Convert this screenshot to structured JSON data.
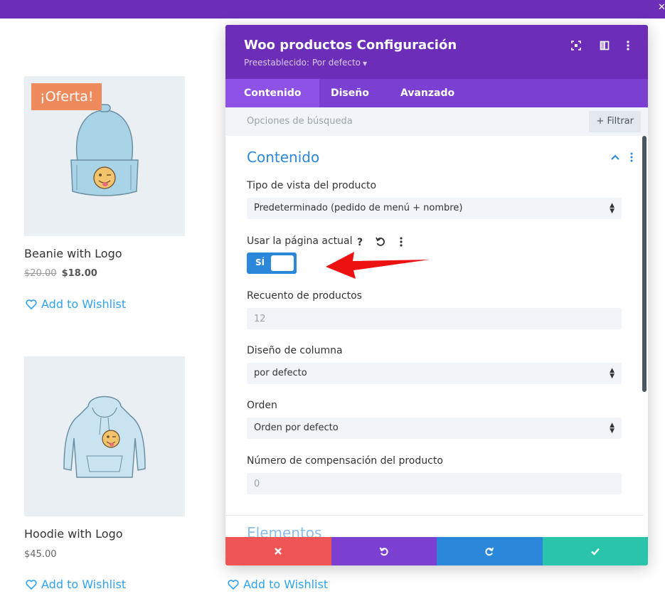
{
  "modal": {
    "title": "Woo productos Configuración",
    "preset": "Preestablecido: Por defecto",
    "tabs": [
      {
        "label": "Contenido"
      },
      {
        "label": "Diseño"
      },
      {
        "label": "Avanzado"
      }
    ],
    "search_placeholder": "Opciones de búsqueda",
    "filter_label": "+ Filtrar",
    "section_title": "Contenido",
    "next_section_title": "Elementos",
    "fields": {
      "view_type_label": "Tipo de vista del producto",
      "view_type_value": "Predeterminado (pedido de menú + nombre)",
      "use_current_label": "Usar la página actual",
      "toggle_label": "SÍ",
      "product_count_label": "Recuento de productos",
      "product_count_value": "12",
      "column_layout_label": "Diseño de columna",
      "column_layout_value": "por defecto",
      "order_label": "Orden",
      "order_value": "Orden por defecto",
      "offset_label": "Número de compensación del producto",
      "offset_value": "0"
    }
  },
  "products": [
    {
      "name": "Beanie with Logo",
      "badge": "¡Oferta!",
      "old_price": "$20.00",
      "price": "$18.00",
      "wishlist": "Add to Wishlist"
    },
    {
      "name": "Hoodie with Logo",
      "price": "$45.00",
      "wishlist": "Add to Wishlist"
    }
  ],
  "extra_wishlist": "Add to Wishlist",
  "colors": {
    "purple": "#6c2eb9",
    "tab_purple": "#7b3fd1",
    "blue": "#2b87da",
    "red": "#ef5555",
    "green": "#29c4a9",
    "sale_orange": "#ef8a5d",
    "link_blue": "#2ea3f2"
  },
  "icons": [
    "focus-icon",
    "split-view-icon",
    "more-vertical-icon",
    "help-icon",
    "reset-icon",
    "chevron-up-icon",
    "heart-icon",
    "close-icon",
    "undo-icon",
    "redo-icon",
    "check-icon"
  ]
}
